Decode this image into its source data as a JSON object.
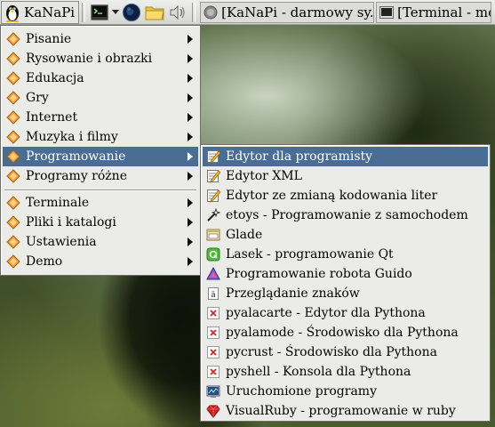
{
  "panel": {
    "start_label": "KaNaPi",
    "launchers": [
      "terminal-icon",
      "globe-icon",
      "folder-icon",
      "volume-icon"
    ],
    "tasks": [
      {
        "title": "[KaNaPi - darmowy sy...",
        "icon": "browser-icon"
      },
      {
        "title": "[Terminal - mc",
        "icon": "terminal-icon"
      }
    ]
  },
  "main_menu": {
    "items": [
      {
        "label": "Pisanie"
      },
      {
        "label": "Rysowanie i obrazki"
      },
      {
        "label": "Edukacja"
      },
      {
        "label": "Gry"
      },
      {
        "label": "Internet"
      },
      {
        "label": "Muzyka i filmy"
      },
      {
        "label": "Programowanie",
        "selected": true
      },
      {
        "label": "Programy różne"
      },
      {
        "label": "Terminale"
      },
      {
        "label": "Pliki i katalogi"
      },
      {
        "label": "Ustawienia"
      },
      {
        "label": "Demo"
      }
    ]
  },
  "sub_menu": {
    "items": [
      {
        "label": "Edytor dla programisty",
        "icon": "text-editor-icon",
        "selected": true
      },
      {
        "label": "Edytor XML",
        "icon": "text-editor-icon"
      },
      {
        "label": "Edytor ze zmianą kodowania liter",
        "icon": "text-editor-icon"
      },
      {
        "label": "etoys - Programowanie z samochodem",
        "icon": "magic-wand-icon"
      },
      {
        "label": "Glade",
        "icon": "glade-icon"
      },
      {
        "label": "Lasek - programowanie Qt",
        "icon": "qt-icon"
      },
      {
        "label": "Programowanie robota Guido",
        "icon": "triangle-icon"
      },
      {
        "label": "Przeglądanie znaków",
        "icon": "character-map-icon"
      },
      {
        "label": "pyalacarte - Edytor dla Pythona",
        "icon": "missing-icon"
      },
      {
        "label": "pyalamode - Środowisko dla Pythona",
        "icon": "missing-icon"
      },
      {
        "label": "pycrust - Środowisko dla Pythona",
        "icon": "missing-icon"
      },
      {
        "label": "pyshell - Konsola dla Pythona",
        "icon": "missing-icon"
      },
      {
        "label": "Uruchomione programy",
        "icon": "process-monitor-icon"
      },
      {
        "label": "VisualRuby - programowanie w ruby",
        "icon": "ruby-icon"
      }
    ]
  }
}
